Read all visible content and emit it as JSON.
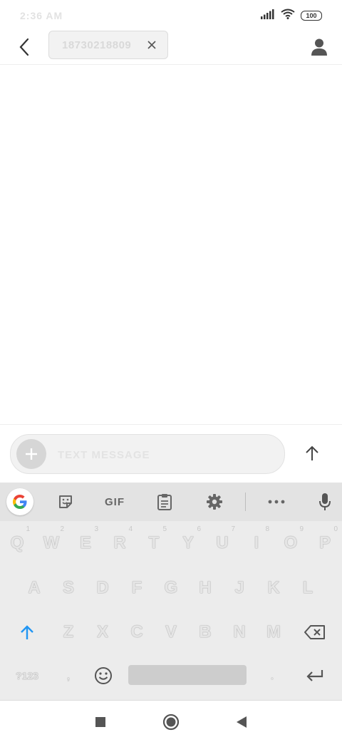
{
  "status_bar": {
    "time": "2:36 AM",
    "battery": "100",
    "icons": [
      "signal-icon",
      "wifi-icon",
      "battery-icon"
    ]
  },
  "header": {
    "recipient": "18730218809",
    "icons": {
      "back": "back-arrow-icon",
      "chip_close": "close-icon",
      "contact": "person-icon"
    }
  },
  "compose": {
    "placeholder": "TEXT MESSAGE",
    "icons": {
      "add": "plus-icon",
      "send": "arrow-up-icon"
    }
  },
  "keyboard": {
    "toolbar": {
      "gif_label": "GIF",
      "icons": [
        "google-icon",
        "sticker-icon",
        "clipboard-icon",
        "gear-icon",
        "more-icon",
        "microphone-icon"
      ]
    },
    "row1": [
      {
        "key": "Q",
        "hint": "1"
      },
      {
        "key": "W",
        "hint": "2"
      },
      {
        "key": "E",
        "hint": "3"
      },
      {
        "key": "R",
        "hint": "4"
      },
      {
        "key": "T",
        "hint": "5"
      },
      {
        "key": "Y",
        "hint": "6"
      },
      {
        "key": "U",
        "hint": "7"
      },
      {
        "key": "I",
        "hint": "8"
      },
      {
        "key": "O",
        "hint": "9"
      },
      {
        "key": "P",
        "hint": "0"
      }
    ],
    "row2": [
      "A",
      "S",
      "D",
      "F",
      "G",
      "H",
      "J",
      "K",
      "L"
    ],
    "row3": [
      "Z",
      "X",
      "C",
      "V",
      "B",
      "N",
      "M"
    ],
    "row4": {
      "symbols": "?123",
      "comma": ",",
      "period": "."
    },
    "colors": {
      "shift_accent": "#2196F3"
    }
  },
  "navbar": {
    "icons": [
      "recents-square-icon",
      "home-circle-icon",
      "back-triangle-icon"
    ]
  }
}
